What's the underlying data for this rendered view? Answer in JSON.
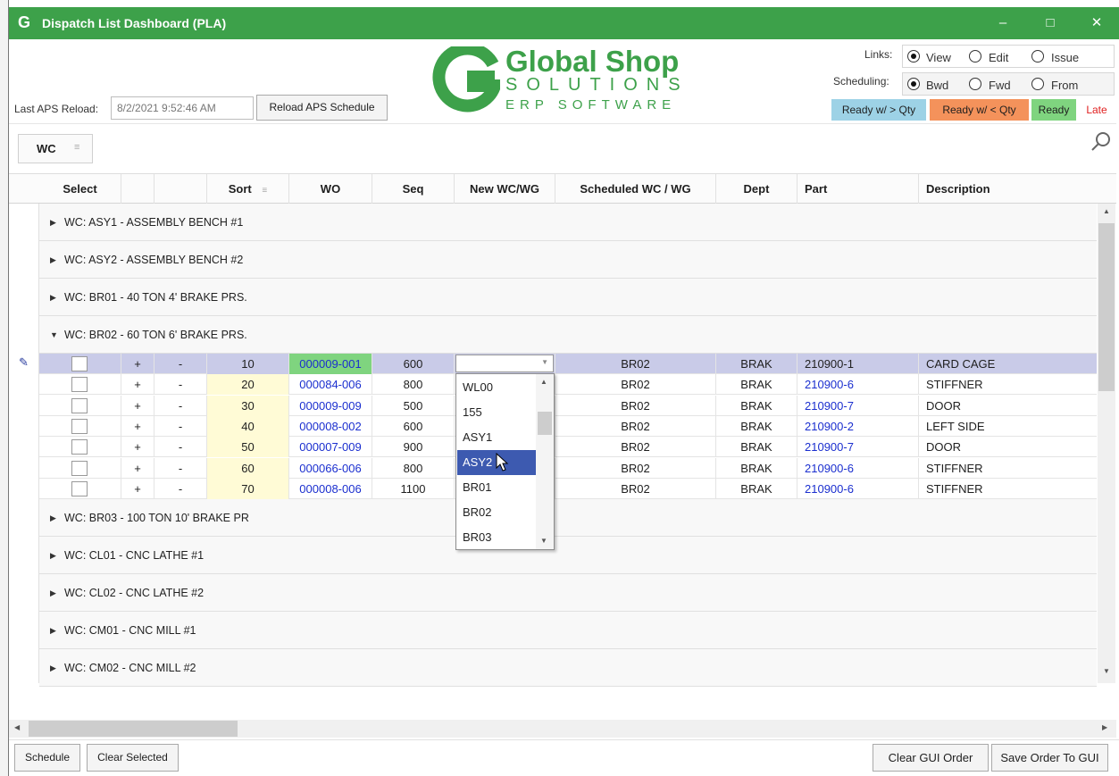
{
  "window": {
    "title": "Dispatch List Dashboard (PLA)",
    "app_glyph": "G",
    "minimize": "–",
    "maximize": "□",
    "close": "✕"
  },
  "header": {
    "last_aps_label": "Last APS Reload:",
    "last_aps_value": "8/2/2021 9:52:46 AM",
    "reload_button": "Reload APS Schedule",
    "logo": {
      "line1": "Global Shop",
      "line2": "SOLUTIONS",
      "line3": "ERP SOFTWARE",
      "color": "#3da14a"
    },
    "links_label": "Links:",
    "links_options": [
      "View",
      "Edit",
      "Issue"
    ],
    "links_selected": "View",
    "scheduling_label": "Scheduling:",
    "scheduling_options": [
      "Bwd",
      "Fwd",
      "From"
    ],
    "scheduling_selected": "Bwd",
    "legend": [
      {
        "label": "Ready w/ > Qty",
        "color": "#9dd2e6"
      },
      {
        "label": "Ready w/  < Qty",
        "color": "#f4925b"
      },
      {
        "label": "Ready",
        "color": "#7fd47f"
      },
      {
        "label": "Late",
        "color": "#ffffff",
        "text_color": "#e02020"
      }
    ]
  },
  "group_panel": {
    "chip": "WC",
    "search_icon": "search-icon"
  },
  "columns": [
    "Select",
    "",
    "",
    "Sort",
    "WO",
    "Seq",
    "New WC/WG",
    "Scheduled WC / WG",
    "Dept",
    "Part",
    "Description"
  ],
  "groups_before": [
    "WC: ASY1 - ASSEMBLY BENCH #1",
    "WC: ASY2 - ASSEMBLY BENCH #2",
    "WC: BR01 - 40 TON 4' BRAKE PRS."
  ],
  "expanded_group": "WC: BR02 - 60 TON 6' BRAKE PRS.",
  "rows": [
    {
      "plus": "+",
      "minus": "-",
      "sort": "10",
      "wo": "000009-001",
      "seq": "600",
      "sched": "BR02",
      "dept": "BRAK",
      "part": "210900-1",
      "desc": "CARD CAGE"
    },
    {
      "plus": "+",
      "minus": "-",
      "sort": "20",
      "wo": "000084-006",
      "seq": "800",
      "sched": "BR02",
      "dept": "BRAK",
      "part": "210900-6",
      "desc": "STIFFNER"
    },
    {
      "plus": "+",
      "minus": "-",
      "sort": "30",
      "wo": "000009-009",
      "seq": "500",
      "sched": "BR02",
      "dept": "BRAK",
      "part": "210900-7",
      "desc": "DOOR"
    },
    {
      "plus": "+",
      "minus": "-",
      "sort": "40",
      "wo": "000008-002",
      "seq": "600",
      "sched": "BR02",
      "dept": "BRAK",
      "part": "210900-2",
      "desc": "LEFT SIDE"
    },
    {
      "plus": "+",
      "minus": "-",
      "sort": "50",
      "wo": "000007-009",
      "seq": "900",
      "sched": "BR02",
      "dept": "BRAK",
      "part": "210900-7",
      "desc": "DOOR"
    },
    {
      "plus": "+",
      "minus": "-",
      "sort": "60",
      "wo": "000066-006",
      "seq": "800",
      "sched": "BR02",
      "dept": "BRAK",
      "part": "210900-6",
      "desc": "STIFFNER"
    },
    {
      "plus": "+",
      "minus": "-",
      "sort": "70",
      "wo": "000008-006",
      "seq": "1100",
      "sched": "BR02",
      "dept": "BRAK",
      "part": "210900-6",
      "desc": "STIFFNER"
    }
  ],
  "dropdown_options": [
    "WL00",
    "155",
    "ASY1",
    "ASY2",
    "BR01",
    "BR02",
    "BR03"
  ],
  "dropdown_highlighted": "ASY2",
  "groups_after": [
    "WC: BR03 - 100 TON 10' BRAKE PR",
    "WC: CL01 - CNC LATHE #1",
    "WC: CL02 - CNC LATHE #2",
    "WC: CM01 - CNC MILL #1",
    "WC: CM02 - CNC MILL #2"
  ],
  "footer": {
    "schedule": "Schedule",
    "clear_selected": "Clear Selected",
    "clear_gui_order": "Clear GUI Order",
    "save_order": "Save Order To GUI"
  }
}
